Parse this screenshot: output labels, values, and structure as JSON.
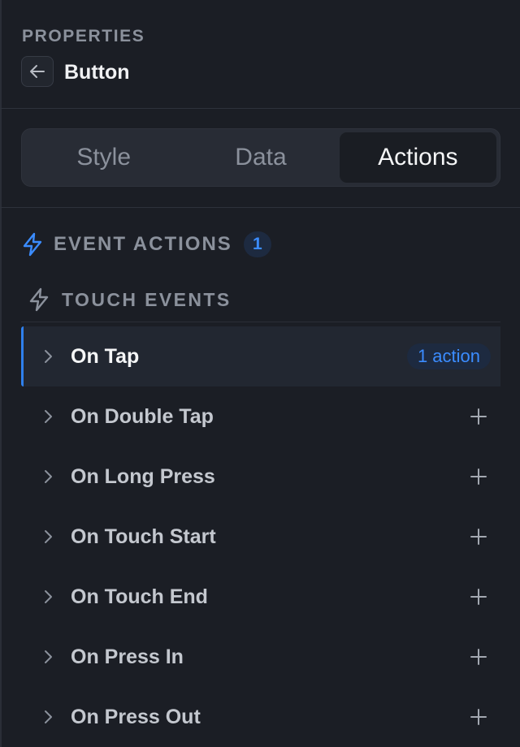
{
  "header": {
    "label": "PROPERTIES",
    "component_name": "Button",
    "back_icon": "arrow-left-icon"
  },
  "tabs": [
    {
      "label": "Style",
      "active": false
    },
    {
      "label": "Data",
      "active": false
    },
    {
      "label": "Actions",
      "active": true
    }
  ],
  "section": {
    "icon": "lightning-icon",
    "title": "EVENT ACTIONS",
    "count": "1",
    "accent_color": "#3b8cff"
  },
  "group": {
    "icon": "lightning-outline-icon",
    "title": "TOUCH EVENTS"
  },
  "events": [
    {
      "label": "On Tap",
      "badge": "1 action",
      "active": true
    },
    {
      "label": "On Double Tap"
    },
    {
      "label": "On Long Press"
    },
    {
      "label": "On Touch Start"
    },
    {
      "label": "On Touch End"
    },
    {
      "label": "On Press In"
    },
    {
      "label": "On Press Out"
    }
  ]
}
